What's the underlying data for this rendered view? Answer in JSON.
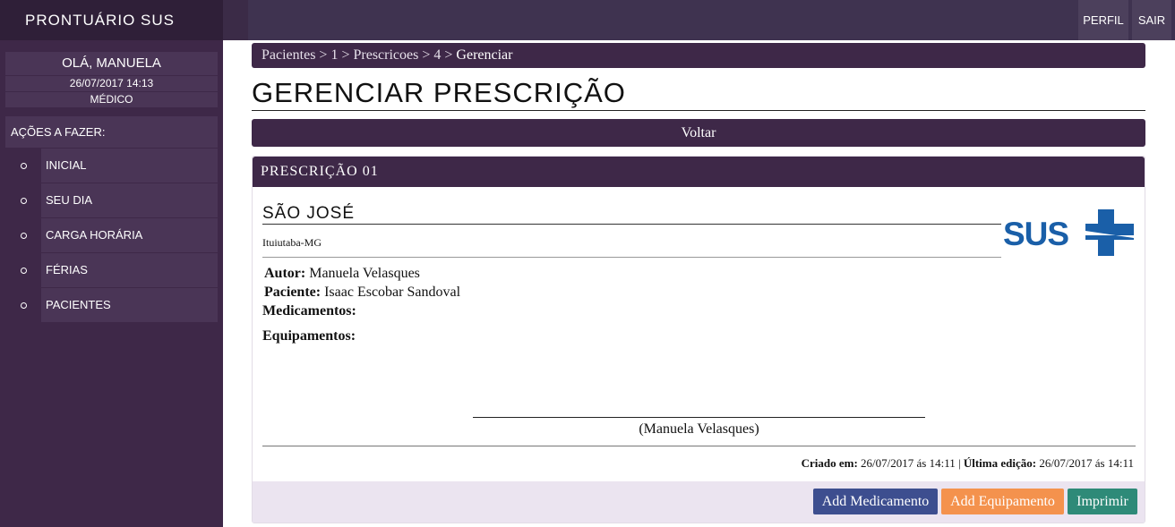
{
  "app": {
    "title": "PRONTUÁRIO SUS"
  },
  "user": {
    "greeting": "OLÁ, MANUELA",
    "datetime": "26/07/2017 14:13",
    "role": "MÉDICO"
  },
  "sidebar": {
    "section_label": "AÇÕES A FAZER:",
    "items": [
      {
        "label": "INICIAL"
      },
      {
        "label": "SEU DIA"
      },
      {
        "label": "CARGA HORÁRIA"
      },
      {
        "label": "FÉRIAS"
      },
      {
        "label": "PACIENTES"
      }
    ]
  },
  "topbar": {
    "perfil": "PERFIL",
    "sair": "SAIR"
  },
  "breadcrumb": {
    "items": [
      "Pacientes",
      "1",
      "Prescricoes",
      "4"
    ],
    "separator": " > ",
    "current": "Gerenciar"
  },
  "page": {
    "title": "GERENCIAR PRESCRIÇÃO",
    "back_label": "Voltar"
  },
  "prescription": {
    "header": "PRESCRIÇÃO 01",
    "hospital": "SÃO JOSÉ",
    "city": "Ituiutaba-MG",
    "logo_text": "SUS",
    "logo_color": "#1a5fa8",
    "author_label": "Autor:",
    "author": "Manuela Velasques",
    "patient_label": "Paciente:",
    "patient": "Isaac Escobar Sandoval",
    "medications_label": "Medicamentos:",
    "equipment_label": "Equipamentos:",
    "signature": "(Manuela Velasques)",
    "created_label": "Criado em:",
    "created": "26/07/2017 ás 14:11",
    "meta_sep": "|",
    "edited_label": "Última edição:",
    "edited": "26/07/2017 ás 14:11"
  },
  "actions": {
    "add_medication": "Add Medicamento",
    "add_equipment": "Add Equipamento",
    "print": "Imprimir"
  }
}
